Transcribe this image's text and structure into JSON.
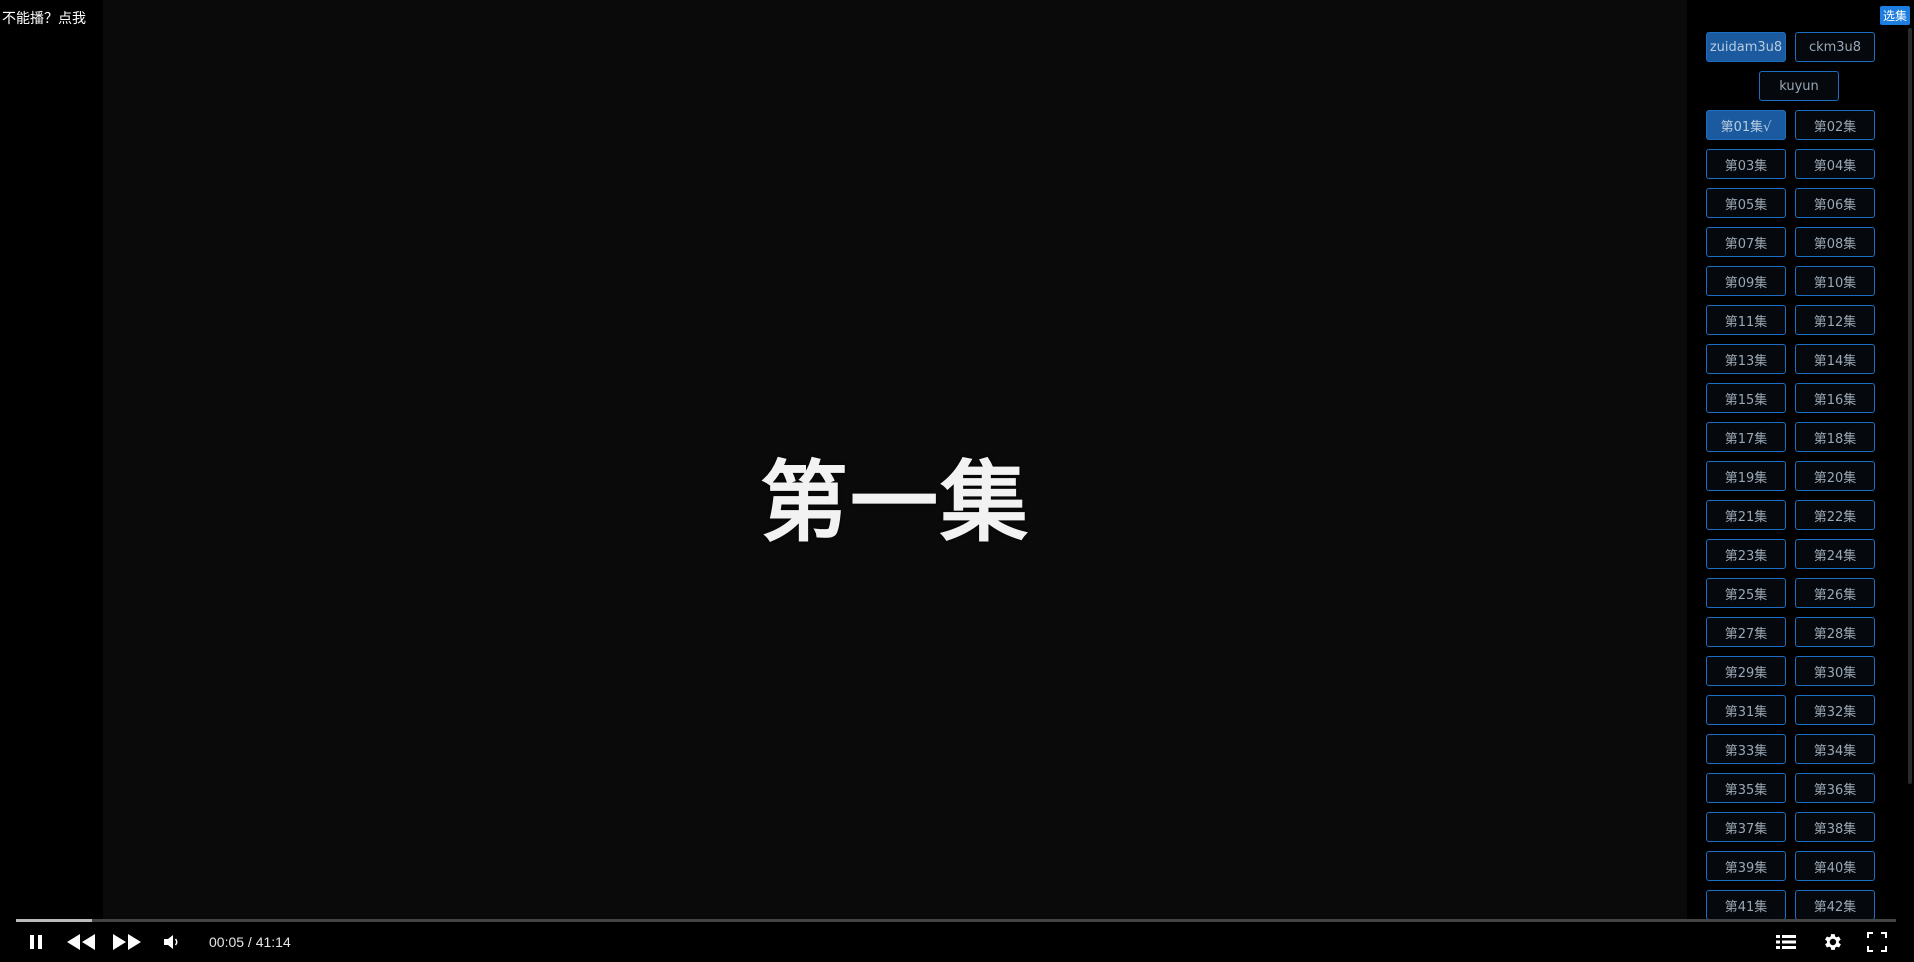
{
  "player": {
    "help_link": "不能播？点我",
    "select_episode_badge": "选集",
    "episode_title": "第一集",
    "progress": 0.0404,
    "time_current": "00:05",
    "time_separator": " / ",
    "time_total": "41:14"
  },
  "sources": [
    {
      "label": "zuidam3u8",
      "active": true
    },
    {
      "label": "ckm3u8",
      "active": false
    },
    {
      "label": "kuyun",
      "active": false
    }
  ],
  "episodes": [
    {
      "label": "第01集√",
      "active": true
    },
    {
      "label": "第02集"
    },
    {
      "label": "第03集"
    },
    {
      "label": "第04集"
    },
    {
      "label": "第05集"
    },
    {
      "label": "第06集"
    },
    {
      "label": "第07集"
    },
    {
      "label": "第08集"
    },
    {
      "label": "第09集"
    },
    {
      "label": "第10集"
    },
    {
      "label": "第11集"
    },
    {
      "label": "第12集"
    },
    {
      "label": "第13集"
    },
    {
      "label": "第14集"
    },
    {
      "label": "第15集"
    },
    {
      "label": "第16集"
    },
    {
      "label": "第17集"
    },
    {
      "label": "第18集"
    },
    {
      "label": "第19集"
    },
    {
      "label": "第20集"
    },
    {
      "label": "第21集"
    },
    {
      "label": "第22集"
    },
    {
      "label": "第23集"
    },
    {
      "label": "第24集"
    },
    {
      "label": "第25集"
    },
    {
      "label": "第26集"
    },
    {
      "label": "第27集"
    },
    {
      "label": "第28集"
    },
    {
      "label": "第29集"
    },
    {
      "label": "第30集"
    },
    {
      "label": "第31集"
    },
    {
      "label": "第32集"
    },
    {
      "label": "第33集"
    },
    {
      "label": "第34集"
    },
    {
      "label": "第35集"
    },
    {
      "label": "第36集"
    },
    {
      "label": "第37集"
    },
    {
      "label": "第38集"
    },
    {
      "label": "第39集"
    },
    {
      "label": "第40集"
    },
    {
      "label": "第41集"
    },
    {
      "label": "第42集"
    }
  ],
  "controls": {
    "icons": [
      "pause-icon",
      "rewind-icon",
      "fast-forward-icon",
      "volume-icon",
      "playlist-icon",
      "gear-icon",
      "fullscreen-icon"
    ]
  },
  "colors": {
    "accent": "#1b6fc2",
    "active_button": "#1b5a9e",
    "badge": "#1e7de0"
  }
}
